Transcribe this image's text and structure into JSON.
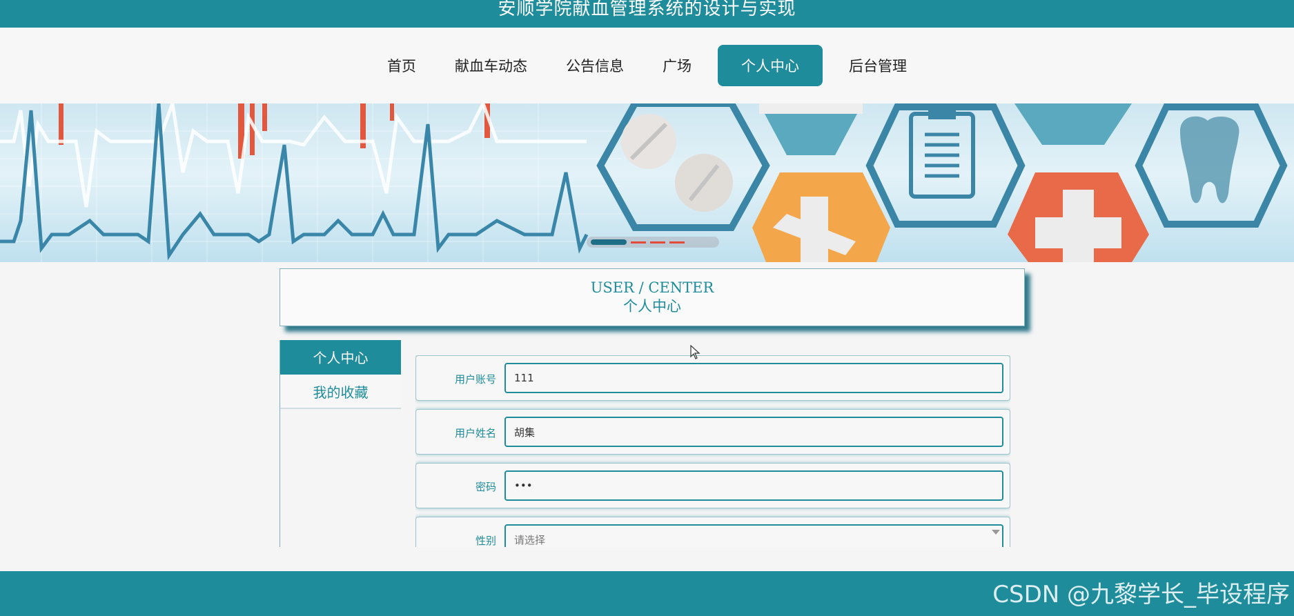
{
  "site": {
    "title": "安顺学院献血管理系统的设计与实现"
  },
  "nav": {
    "items": [
      {
        "label": "首页"
      },
      {
        "label": "献血车动态"
      },
      {
        "label": "公告信息"
      },
      {
        "label": "广场"
      },
      {
        "label": "个人中心"
      },
      {
        "label": "后台管理"
      }
    ],
    "active": "个人中心"
  },
  "banner": {
    "icons": [
      "pill-icon",
      "first-aid-icon",
      "clipboard-icon",
      "tooth-icon",
      "medical-cross-icon",
      "heartbeat-line"
    ]
  },
  "section": {
    "title_en": "USER / CENTER",
    "title_cn": "个人中心"
  },
  "sidebar": {
    "items": [
      {
        "label": "个人中心"
      },
      {
        "label": "我的收藏"
      }
    ],
    "active": "个人中心"
  },
  "form": {
    "fields": [
      {
        "label": "用户账号",
        "value": "111"
      },
      {
        "label": "用户姓名",
        "value": "胡集"
      },
      {
        "label": "密码",
        "value": "•••"
      },
      {
        "label": "性别",
        "value": "",
        "placeholder": "请选择"
      }
    ]
  },
  "watermark": "CSDN @九黎学长_毕设程序",
  "colors": {
    "primary": "#1e8c9b",
    "accent_red": "#e24a3a",
    "accent_orange": "#f3a64a"
  }
}
